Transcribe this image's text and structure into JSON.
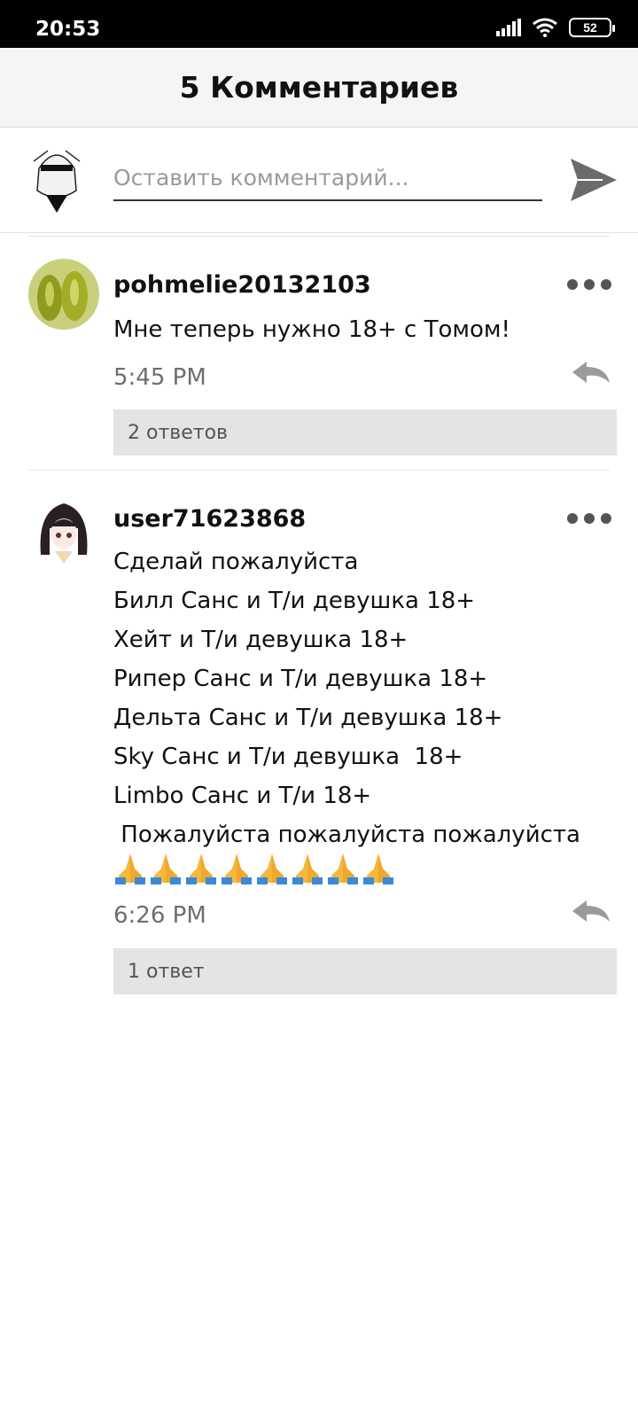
{
  "status": {
    "time": "20:53",
    "battery": "52"
  },
  "header": {
    "title": "5 Комментариев"
  },
  "composer": {
    "placeholder": "Оставить комментарий..."
  },
  "comments": [
    {
      "username": "pohmelie20132103",
      "text": "Мне теперь нужно 18+ с Томом!",
      "time": "5:45 PM",
      "replies": "2 ответов"
    },
    {
      "username": "user71623868",
      "text": "Сделай пожалуйста\nБилл Санс и Т/и девушка 18+\nХейт и Т/и девушка 18+\nРипер Санс и Т/и девушка 18+\nДельта Санс и Т/и девушка 18+\nSky Санс и Т/и девушка  18+\nLimbo Санс и Т/и 18+\n Пожалуйста пожалуйста пожалуйста",
      "emoji_count": 8,
      "time": "6:26 PM",
      "replies": "1 ответ"
    }
  ],
  "colors": {
    "header_bg": "#f5f4f6",
    "reply_bg": "#e4e4e6",
    "muted": "#6e6e6e"
  }
}
